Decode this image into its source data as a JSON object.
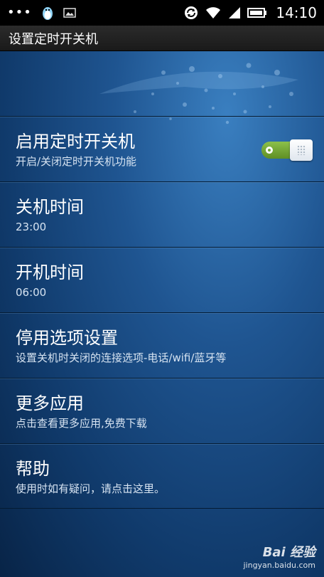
{
  "status_bar": {
    "time": "14:10",
    "left_icons": [
      "more-dots-icon",
      "qq-penguin-icon",
      "image-icon"
    ],
    "right_icons": [
      "sync-icon",
      "wifi-icon",
      "signal-icon",
      "battery-icon"
    ]
  },
  "header": {
    "title": "设置定时开关机"
  },
  "settings": {
    "items": [
      {
        "title": "启用定时开关机",
        "subtitle": "开启/关闭定时开关机功能",
        "toggle_on": true
      },
      {
        "title": "关机时间",
        "subtitle": "23:00"
      },
      {
        "title": "开机时间",
        "subtitle": "06:00"
      },
      {
        "title": "停用选项设置",
        "subtitle": "设置关机时关闭的连接选项-电话/wifi/蓝牙等"
      },
      {
        "title": "更多应用",
        "subtitle": "点击查看更多应用,免费下载"
      },
      {
        "title": "帮助",
        "subtitle": "使用时如有疑问，请点击这里。"
      }
    ]
  },
  "watermark": {
    "logo": "Bai 经验",
    "url": "jingyan.baidu.com"
  },
  "colors": {
    "status_bar_bg": "#000000",
    "title_bar_bg": "#222222",
    "background_blue": "#1f5591",
    "toggle_green": "#7fb03d"
  }
}
